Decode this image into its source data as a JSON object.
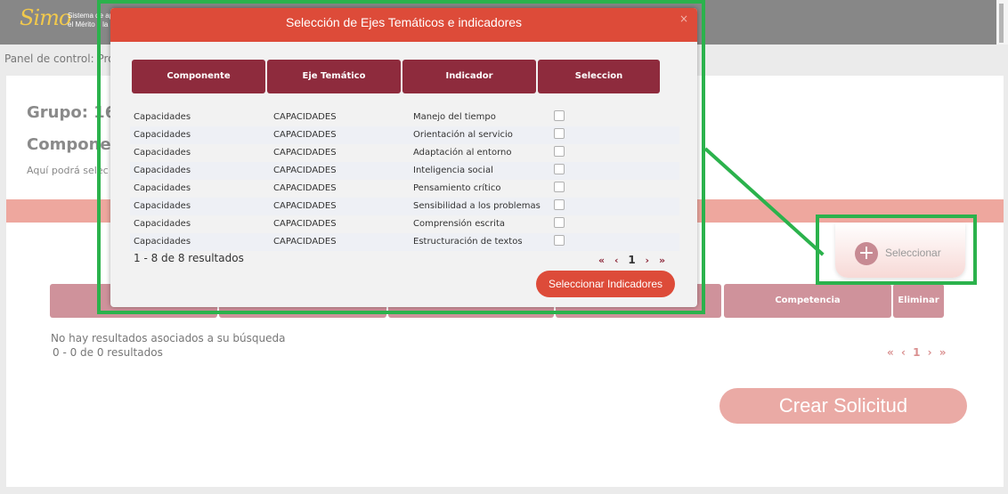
{
  "app": {
    "logo_mark": "Simo",
    "logo_line1": "Sistema de ap",
    "logo_line2": "el Mérito y la"
  },
  "breadcrumb": "Panel de control: Pro",
  "page": {
    "grupo_title": "Grupo: 16",
    "componente_title": "Compone",
    "help_text": "Aquí podrá selec"
  },
  "selector": {
    "label": "Seleccionar",
    "icon": "plus-circle-icon"
  },
  "bg_table": {
    "visible_headers": [
      "Competencia",
      "Eliminar"
    ]
  },
  "bg_results": {
    "empty_message": "No hay resultados asociados a su búsqueda",
    "count": "0 - 0 de 0 resultados",
    "pager": {
      "first": "«",
      "prev": "‹",
      "page": "1",
      "next": "›",
      "last": "»"
    }
  },
  "crear_button": "Crear Solicitud",
  "modal": {
    "title": "Selección de Ejes Temáticos e indicadores",
    "close": "×",
    "headers": [
      "Componente",
      "Eje Temático",
      "Indicador",
      "Seleccion"
    ],
    "rows": [
      {
        "componente": "Capacidades",
        "eje": "CAPACIDADES",
        "indicador": "Manejo del tiempo",
        "checked": false
      },
      {
        "componente": "Capacidades",
        "eje": "CAPACIDADES",
        "indicador": "Orientación al servicio",
        "checked": false
      },
      {
        "componente": "Capacidades",
        "eje": "CAPACIDADES",
        "indicador": "Adaptación al entorno",
        "checked": false
      },
      {
        "componente": "Capacidades",
        "eje": "CAPACIDADES",
        "indicador": "Inteligencia social",
        "checked": false
      },
      {
        "componente": "Capacidades",
        "eje": "CAPACIDADES",
        "indicador": "Pensamiento crítico",
        "checked": false
      },
      {
        "componente": "Capacidades",
        "eje": "CAPACIDADES",
        "indicador": "Sensibilidad a los problemas",
        "checked": false
      },
      {
        "componente": "Capacidades",
        "eje": "CAPACIDADES",
        "indicador": "Comprensión escrita",
        "checked": false
      },
      {
        "componente": "Capacidades",
        "eje": "CAPACIDADES",
        "indicador": "Estructuración de textos",
        "checked": false
      }
    ],
    "count": "1 - 8 de 8 resultados",
    "pager": {
      "first": "«",
      "prev": "‹",
      "page": "1",
      "next": "›",
      "last": "»"
    },
    "submit": "Seleccionar Indicadores"
  },
  "colors": {
    "modal_header": "#dd4b39",
    "table_header": "#8e2b3d",
    "annotation": "#2bb24c",
    "salmon": "#eea79e"
  }
}
